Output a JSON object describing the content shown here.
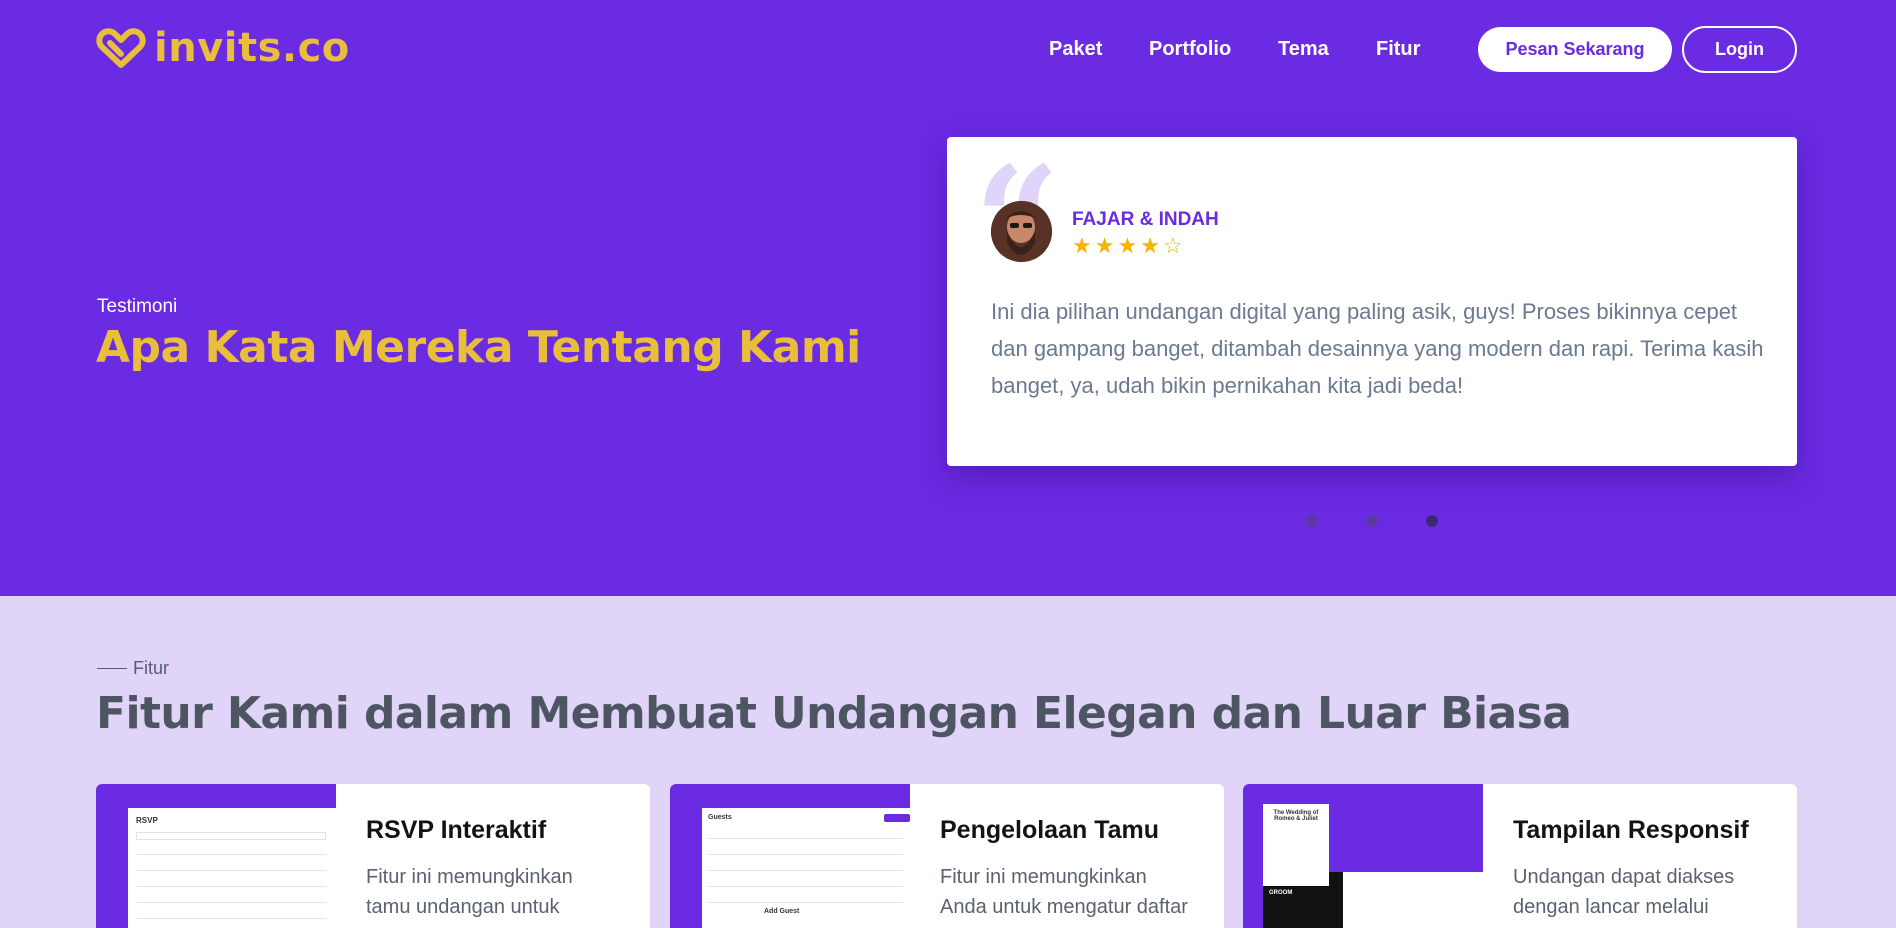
{
  "brand": {
    "name": "invits.co"
  },
  "nav": {
    "items": [
      "Paket",
      "Portfolio",
      "Tema",
      "Fitur"
    ],
    "cta": "Pesan Sekarang",
    "login": "Login"
  },
  "testimonials": {
    "label": "Testimoni",
    "title": "Apa Kata Mereka Tentang Kami",
    "active": {
      "name": "FAJAR & INDAH",
      "rating": 4,
      "max_rating": 5,
      "text": "Ini dia pilihan undangan digital yang paling asik, guys! Proses bikinnya cepet dan gampang banget, ditambah desainnya yang modern dan rapi. Terima kasih banget, ya, udah bikin pernikahan kita jadi beda!"
    },
    "slides": 3,
    "active_slide": 3
  },
  "features": {
    "label": "Fitur",
    "title": "Fitur Kami dalam Membuat Undangan Elegan dan Luar Biasa",
    "cards": [
      {
        "title": "RSVP Interaktif",
        "text": "Fitur ini memungkinkan tamu undangan untuk",
        "thumb_title": "RSVP"
      },
      {
        "title": "Pengelolaan Tamu",
        "text": "Fitur ini memungkinkan Anda untuk mengatur daftar",
        "thumb_title": "Guests",
        "thumb_sub": "Add Guest"
      },
      {
        "title": "Tampilan Responsif",
        "text": "Undangan dapat diakses dengan lancar melalui",
        "thumb_title": "The Wedding of Romeo & Juliet",
        "thumb_sub": "GROOM"
      }
    ]
  },
  "colors": {
    "primary": "#6a2be2",
    "accent": "#e8be3c",
    "light": "#e0d4f8"
  }
}
